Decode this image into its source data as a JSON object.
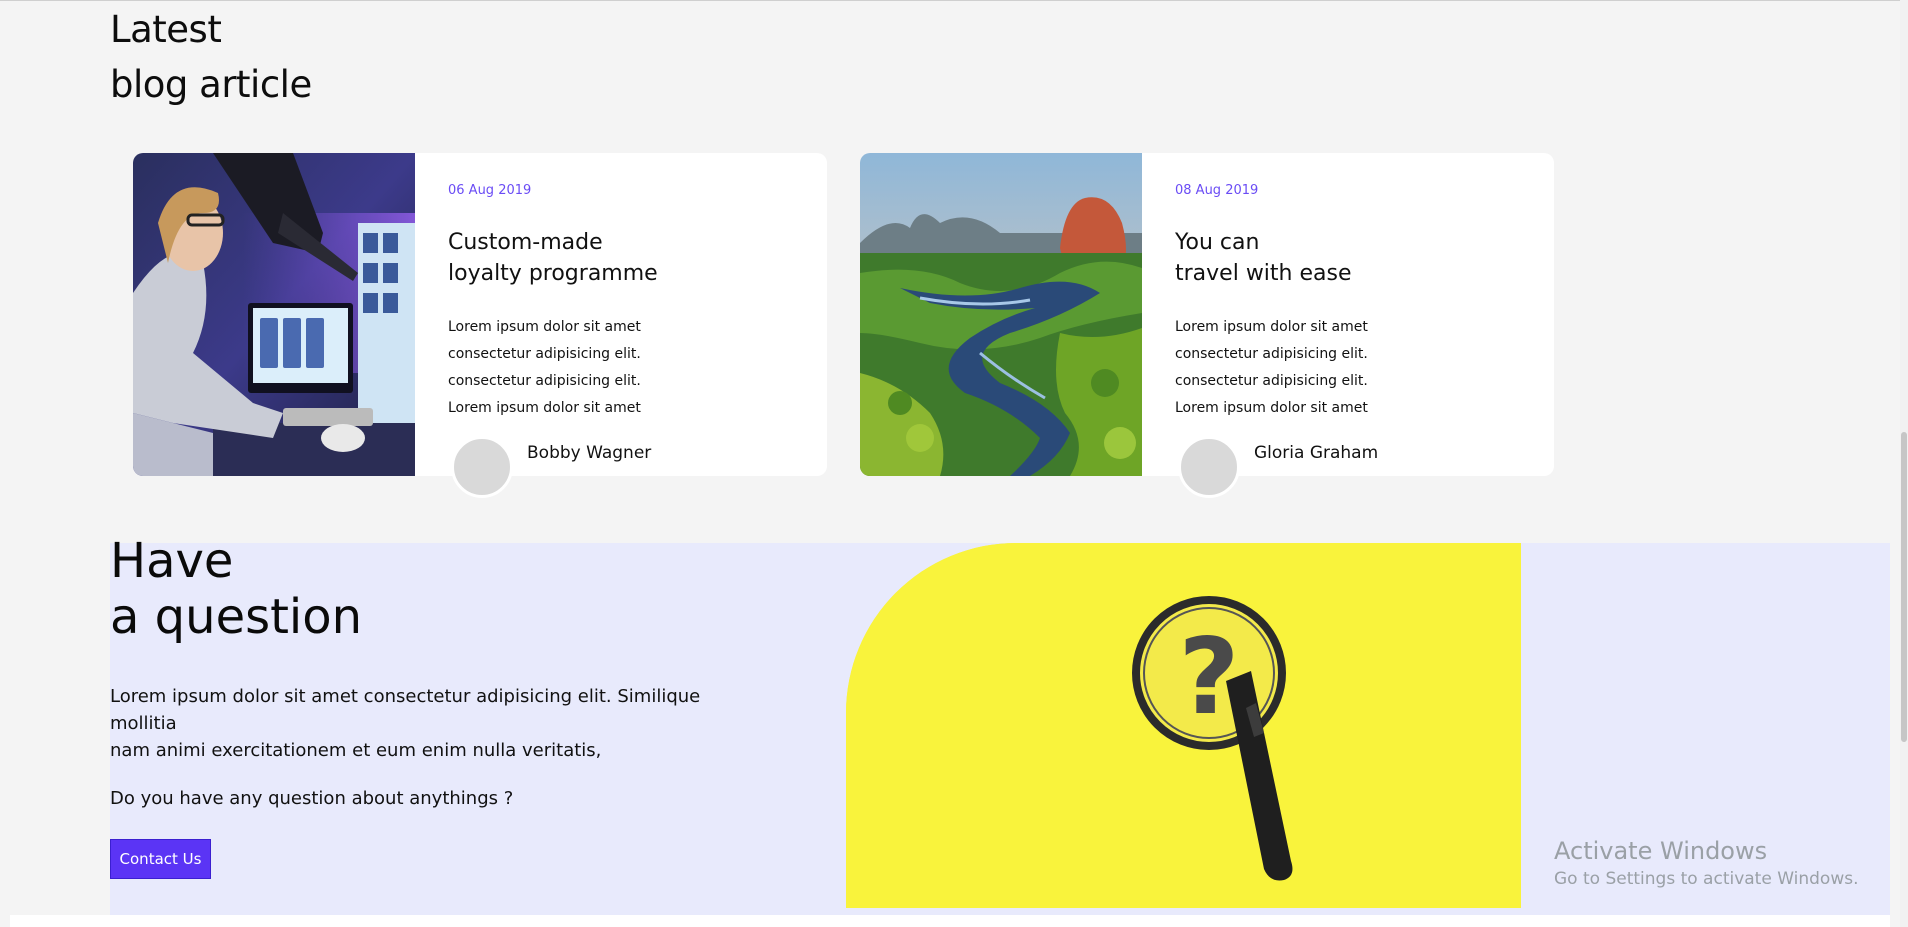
{
  "blog": {
    "title_line1": "Latest",
    "title_line2": "blog article",
    "cards": [
      {
        "date": "06 Aug 2019",
        "title_line1": "Custom-made",
        "title_line2": "loyalty programme",
        "excerpt": [
          "Lorem ipsum dolor sit amet",
          "consectetur adipisicing elit.",
          "consectetur adipisicing elit.",
          "Lorem ipsum dolor sit amet"
        ],
        "author": "Bobby Wagner",
        "image": "designer-at-computer-photo"
      },
      {
        "date": "08 Aug 2019",
        "title_line1": "You can",
        "title_line2": "travel with ease",
        "excerpt": [
          "Lorem ipsum dolor sit amet",
          "consectetur adipisicing elit.",
          "consectetur adipisicing elit.",
          "Lorem ipsum dolor sit amet"
        ],
        "author": "Gloria Graham",
        "image": "river-landscape-photo"
      }
    ]
  },
  "question": {
    "title_line1": "Have",
    "title_line2": "a question",
    "body_line1": "Lorem ipsum dolor sit amet consectetur adipisicing elit. Similique",
    "body_line2": "mollitia",
    "body_line3": "nam animi exercitationem et eum enim nulla veritatis,",
    "prompt": "Do you have any question about anythings ?",
    "button_label": "Contact Us",
    "image": "magnifying-glass-question-photo"
  },
  "watermark": {
    "line1": "Activate Windows",
    "line2": "Go to Settings to activate Windows."
  },
  "colors": {
    "accent": "#5b34f5",
    "date": "#6a4cf5",
    "faq_bg": "#e8eafc",
    "faq_image_bg": "#f9f33c",
    "page_bg": "#f4f4f4"
  }
}
